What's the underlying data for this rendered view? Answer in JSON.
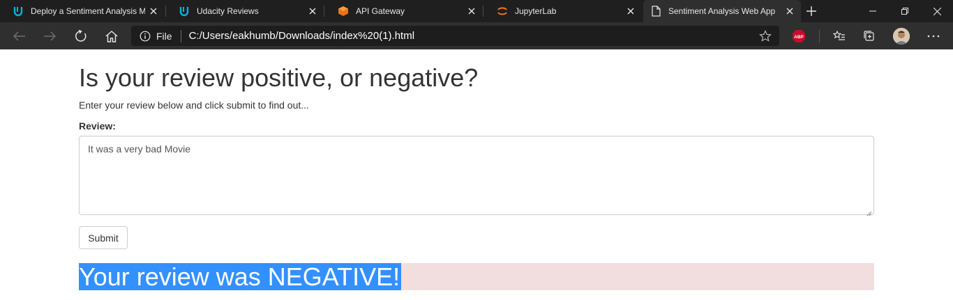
{
  "browser": {
    "tabs": [
      {
        "title": "Deploy a Sentiment Analysis M",
        "icon": "udacity-icon"
      },
      {
        "title": "Udacity Reviews",
        "icon": "udacity-icon"
      },
      {
        "title": "API Gateway",
        "icon": "aws-api-gateway-icon"
      },
      {
        "title": "JupyterLab",
        "icon": "jupyter-icon"
      },
      {
        "title": "Sentiment Analysis Web App",
        "icon": "page-icon"
      }
    ],
    "address": {
      "scheme_label": "File",
      "url": "C:/Users/eakhumb/Downloads/index%20(1).html"
    },
    "colors": {
      "tabstrip": "#1f1f1f",
      "toolbar": "#2f2f2f",
      "abp_badge": "#c70d2c"
    }
  },
  "page": {
    "heading": "Is your review positive, or negative?",
    "subtitle": "Enter your review below and click submit to find out...",
    "review_label": "Review:",
    "review_value": "It was a very bad Movie",
    "submit_label": "Submit",
    "result_text": "Your review was NEGATIVE!",
    "colors": {
      "result_background": "#f2dede",
      "selection_highlight": "#3390ff"
    }
  }
}
